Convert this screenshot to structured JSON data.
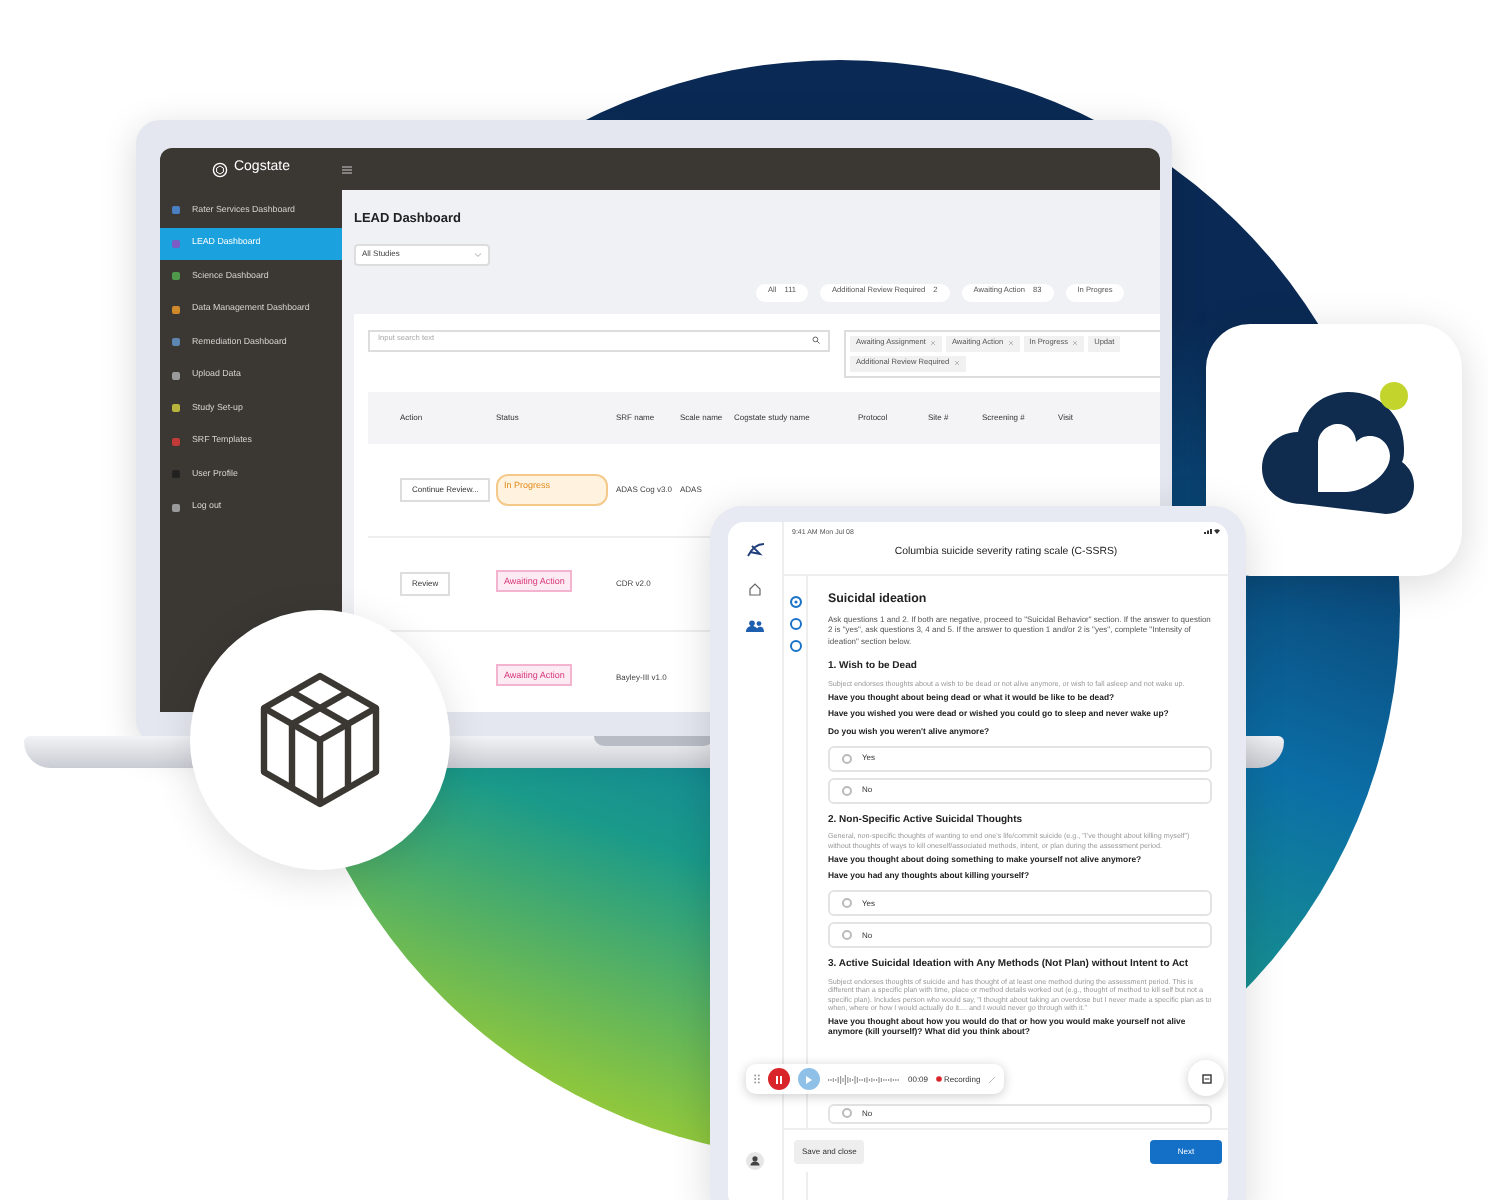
{
  "laptop": {
    "brand": "Cogstate",
    "sidebar": {
      "items": [
        {
          "label": "Rater Services Dashboard",
          "selected": false,
          "color": "#4a7fc1"
        },
        {
          "label": "LEAD Dashboard",
          "selected": true,
          "color": "#7b5cc4"
        },
        {
          "label": "Science Dashboard",
          "selected": false,
          "color": "#4f9a4a"
        },
        {
          "label": "Data Management Dashboard",
          "selected": false,
          "color": "#d08a2a"
        },
        {
          "label": "Remediation Dashboard",
          "selected": false,
          "color": "#5d86b0"
        },
        {
          "label": "Upload Data",
          "selected": false,
          "color": "#9a9a9a"
        },
        {
          "label": "Study Set-up",
          "selected": false,
          "color": "#b7b43a"
        },
        {
          "label": "SRF Templates",
          "selected": false,
          "color": "#c03a3a"
        },
        {
          "label": "User Profile",
          "selected": false,
          "color": "#222222"
        },
        {
          "label": "Log out",
          "selected": false,
          "color": "#9a9a9a"
        }
      ]
    },
    "page_title": "LEAD Dashboard",
    "study_select": {
      "value": "All Studies"
    },
    "filter_chips": [
      {
        "label": "All",
        "count": "111"
      },
      {
        "label": "Additional Review Required",
        "count": "2"
      },
      {
        "label": "Awaiting Action",
        "count": "83"
      },
      {
        "label": "In Progres"
      }
    ],
    "search": {
      "placeholder": "Input search text"
    },
    "status_tags": [
      {
        "label": "Awaiting Assignment",
        "removable": true
      },
      {
        "label": "Awaiting Action",
        "removable": true
      },
      {
        "label": "In Progress",
        "removable": true
      },
      {
        "label": "Updat",
        "removable": false
      },
      {
        "label": "Additional Review Required",
        "removable": true
      }
    ],
    "table": {
      "columns": [
        "Action",
        "Status",
        "SRF name",
        "Scale name",
        "Cogstate study name",
        "Protocol",
        "Site #",
        "Screening #",
        "Visit"
      ],
      "rows": [
        {
          "action": "Continue Review...",
          "status": "In Progress",
          "kind": "progress",
          "srf_name": "ADAS Cog v3.0",
          "scale_name": "ADAS"
        },
        {
          "action": "Review",
          "status": "Awaiting Action",
          "kind": "awaiting",
          "srf_name": "CDR v2.0"
        },
        {
          "status": "Awaiting Action",
          "kind": "awaiting",
          "srf_name": "Bayley-III v1.0"
        }
      ]
    }
  },
  "tablet": {
    "status_time": "9:41 AM  Mon Jul 08",
    "title": "Columbia suicide severity rating scale (C-SSRS)",
    "stepper": [
      {
        "selected": true
      },
      {
        "selected": false
      },
      {
        "selected": false
      }
    ],
    "section_title": "Suicidal ideation",
    "intro": "Ask questions 1 and 2.  If both are negative, proceed to \"Suicidal Behavior\" section. If the answer to question 2 is \"yes\", ask questions 3, 4 and 5.  If the answer to question 1 and/or 2 is \"yes\", complete \"Intensity of ideation\" section below.",
    "questions": [
      {
        "title": "1. Wish to be Dead",
        "description": "Subject endorses thoughts about a wish to be dead or not alive anymore, or wish to fall asleep and not wake up.",
        "prompts": [
          "Have you thought about being dead or what it would be like to be dead?",
          "Have you wished you were dead or wished you could go to sleep and never wake up?",
          "Do you wish you weren't alive anymore?"
        ],
        "options": [
          {
            "label": "Yes",
            "selected": false
          },
          {
            "label": "No",
            "selected": false
          }
        ]
      },
      {
        "title": "2. Non-Specific Active Suicidal Thoughts",
        "description": "General, non-specific thoughts of wanting to end one's life/commit suicide (e.g., \"I've thought about killing myself\") without thoughts of ways to kill oneself/associated methods, intent, or plan during the assessment period.",
        "prompts": [
          "Have you thought about doing something to make yourself not alive anymore?",
          "Have you had any thoughts about killing yourself?"
        ],
        "options": [
          {
            "label": "Yes",
            "selected": false
          },
          {
            "label": "No",
            "selected": false
          }
        ]
      },
      {
        "title": "3. Active Suicidal Ideation with Any Methods (Not Plan) without Intent to Act",
        "description": "Subject endorses thoughts of suicide and has thought of at least one method during the assessment period. This is different than a specific plan with time, place or method details worked out (e.g., thought of method to kill self but not a specific plan). Includes person who would say, \"I thought about taking an overdose but I never made a specific plan as to when, where or how I would actually do it.... and I would never go through with it.\"",
        "prompts": [
          "Have you thought about how you would do that or how you would make yourself not alive anymore (kill yourself)? What did you think about?"
        ],
        "options": [
          {
            "label": "No",
            "selected": false
          }
        ]
      }
    ],
    "recorder": {
      "time": "00:09",
      "status": "Recording",
      "recording": true
    },
    "save_button": "Save and close",
    "next_button": "Next"
  }
}
